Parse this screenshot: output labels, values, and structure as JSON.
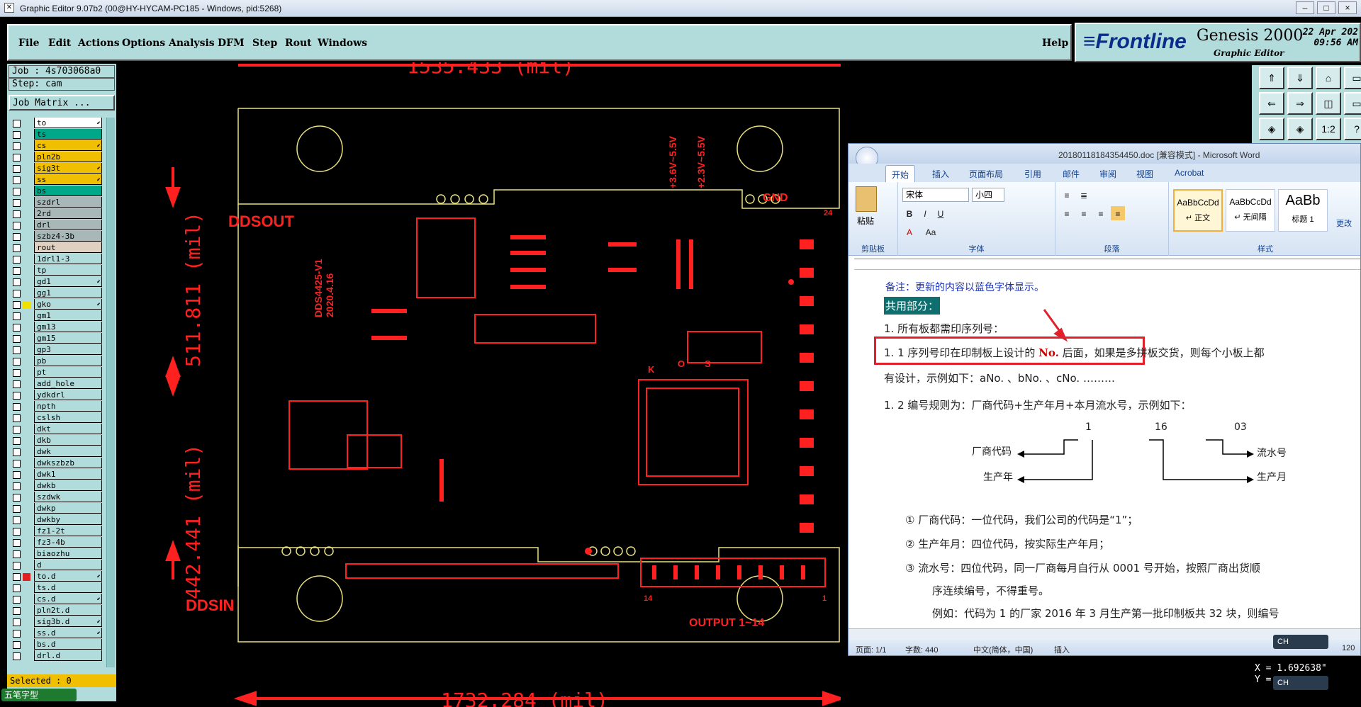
{
  "window": {
    "title": "Graphic Editor 9.07b2 (00@HY-HYCAM-PC185 - Windows, pid:5268)",
    "buttons": [
      "–",
      "□",
      "×"
    ]
  },
  "menu": {
    "items": [
      "File",
      "Edit",
      "Actions",
      "Options",
      "Analysis",
      "DFM",
      "Step",
      "Rout",
      "Windows"
    ],
    "help": "Help"
  },
  "brand": {
    "logo_a": "≡F",
    "logo_b": "rontline",
    "product": "Genesis 2000",
    "subtitle": "Graphic Editor",
    "date": "22 Apr 202",
    "time": "09:56 AM"
  },
  "job": {
    "job": "Job : 4s703068a0",
    "step": "Step: cam",
    "matrix": "Job Matrix ..."
  },
  "layers": [
    {
      "name": "to",
      "color": "#ffffff",
      "arrow": true
    },
    {
      "name": "ts",
      "color": "#00a88a",
      "arrow": false
    },
    {
      "name": "cs",
      "color": "#f0c000",
      "arrow": true
    },
    {
      "name": "pln2b",
      "color": "#f0c000",
      "arrow": false
    },
    {
      "name": "sig3t",
      "color": "#f0c000",
      "arrow": true
    },
    {
      "name": "ss",
      "color": "#f0c000",
      "arrow": true
    },
    {
      "name": "bs",
      "color": "#00a88a",
      "arrow": false
    },
    {
      "name": "szdrl",
      "color": "#a8b8b8",
      "arrow": false
    },
    {
      "name": "2rd",
      "color": "#a8b8b8",
      "arrow": false
    },
    {
      "name": "drl",
      "color": "#a8b8b8",
      "arrow": false
    },
    {
      "name": "szbz4-3b",
      "color": "#a8b8b8",
      "arrow": false
    },
    {
      "name": "rout",
      "color": "#e0d0c0",
      "arrow": false
    },
    {
      "name": "1drl1-3",
      "color": "#b2dcdc",
      "arrow": false
    },
    {
      "name": "tp",
      "color": "#b2dcdc",
      "arrow": false
    },
    {
      "name": "gd1",
      "color": "#b2dcdc",
      "arrow": true
    },
    {
      "name": "gg1",
      "color": "#b2dcdc",
      "arrow": false
    },
    {
      "name": "gko",
      "color": "#b2dcdc",
      "arrow": true
    },
    {
      "name": "gm1",
      "color": "#b2dcdc",
      "arrow": false
    },
    {
      "name": "gm13",
      "color": "#b2dcdc",
      "arrow": false
    },
    {
      "name": "gm15",
      "color": "#b2dcdc",
      "arrow": false
    },
    {
      "name": "gp3",
      "color": "#b2dcdc",
      "arrow": false
    },
    {
      "name": "pb",
      "color": "#b2dcdc",
      "arrow": false
    },
    {
      "name": "pt",
      "color": "#b2dcdc",
      "arrow": false
    },
    {
      "name": "add_hole",
      "color": "#b2dcdc",
      "arrow": false
    },
    {
      "name": "ydkdrl",
      "color": "#b2dcdc",
      "arrow": false
    },
    {
      "name": "npth",
      "color": "#b2dcdc",
      "arrow": false
    },
    {
      "name": "cslsh",
      "color": "#b2dcdc",
      "arrow": false
    },
    {
      "name": "dkt",
      "color": "#b2dcdc",
      "arrow": false
    },
    {
      "name": "dkb",
      "color": "#b2dcdc",
      "arrow": false
    },
    {
      "name": "dwk",
      "color": "#b2dcdc",
      "arrow": false
    },
    {
      "name": "dwkszbzb",
      "color": "#b2dcdc",
      "arrow": false
    },
    {
      "name": "dwk1",
      "color": "#b2dcdc",
      "arrow": false
    },
    {
      "name": "dwkb",
      "color": "#b2dcdc",
      "arrow": false
    },
    {
      "name": "szdwk",
      "color": "#b2dcdc",
      "arrow": false
    },
    {
      "name": "dwkp",
      "color": "#b2dcdc",
      "arrow": false
    },
    {
      "name": "dwkby",
      "color": "#b2dcdc",
      "arrow": false
    },
    {
      "name": "fz1-2t",
      "color": "#b2dcdc",
      "arrow": false
    },
    {
      "name": "fz3-4b",
      "color": "#b2dcdc",
      "arrow": false
    },
    {
      "name": "biaozhu",
      "color": "#b2dcdc",
      "arrow": false
    },
    {
      "name": "d",
      "color": "#b2dcdc",
      "arrow": false
    },
    {
      "name": "to.d",
      "color": "#b2dcdc",
      "arrow": true
    },
    {
      "name": "ts.d",
      "color": "#b2dcdc",
      "arrow": false
    },
    {
      "name": "cs.d",
      "color": "#b2dcdc",
      "arrow": true
    },
    {
      "name": "pln2t.d",
      "color": "#b2dcdc",
      "arrow": false
    },
    {
      "name": "sig3b.d",
      "color": "#b2dcdc",
      "arrow": true
    },
    {
      "name": "ss.d",
      "color": "#b2dcdc",
      "arrow": true
    },
    {
      "name": "bs.d",
      "color": "#b2dcdc",
      "arrow": false
    },
    {
      "name": "drl.d",
      "color": "#b2dcdc",
      "arrow": false
    }
  ],
  "selected": "Selected : 0",
  "ime": {
    "left": "五笔字型",
    "right": "CH"
  },
  "pcb": {
    "dim_top": "1535.433 (mil)",
    "dim_bottom": "1732.284 (mil)",
    "dim_left_a": "511.811 (mil)",
    "dim_left_b": "442.441 (mil)",
    "label_ddsout": "DDSOUT",
    "label_ddsin": "DDSIN",
    "label_gnd": "GND",
    "label_output": "OUTPUT 1~14",
    "label_v1": "+3.6V~5.5V",
    "label_v2": "+2.3V~5.5V",
    "label_board": "DDS4425-V1",
    "label_date": "2020.4.16",
    "pin_24": "24",
    "pin_14": "14",
    "pin_1": "1",
    "k": "K",
    "o": "O",
    "s": "S"
  },
  "tools": [
    "⇑",
    "⇓",
    "⌂",
    "▭",
    "⇐",
    "⇒",
    "◫",
    "▭",
    "◈",
    "◈",
    "1:2",
    "?"
  ],
  "coords": {
    "x": "X = 1.692638\"",
    "y": "Y = "
  },
  "word": {
    "title": "20180118184354450.doc [兼容模式] - Microsoft Word",
    "tabs": [
      "开始",
      "插入",
      "页面布局",
      "引用",
      "邮件",
      "审阅",
      "视图",
      "Acrobat"
    ],
    "font_name": "宋体",
    "font_size": "小四",
    "groups": [
      "剪贴板",
      "字体",
      "段落",
      "样式"
    ],
    "paste": "粘贴",
    "styles": [
      {
        "sample": "AaBbCcDd",
        "name": "↵ 正文"
      },
      {
        "sample": "AaBbCcDd",
        "name": "↵ 无间隔"
      },
      {
        "sample": "AaBb",
        "name": "标题 1"
      }
    ],
    "more": "更改",
    "doc": {
      "note": "备注：更新的内容以蓝色字体显示。",
      "heading": "共用部分：",
      "p1": "1. 所有板都需印序列号：",
      "p11a": "1. 1 序列号印在印制板上设计的 ",
      "p11b": "No.",
      "p11c": "  后面，",
      "p11d": "如果是多拼板交货，则每个小板上都",
      "p11e": "有设计，示例如下：aNo.  、bNo. 、cNo. ………",
      "p12": "1. 2  编号规则为：厂商代码+生产年月+本月流水号，示例如下：",
      "n1": "1",
      "n16": "16",
      "n03": "03",
      "l_factory": "厂商代码",
      "l_year": "生产年",
      "r_serial": "流水号",
      "r_month": "生产月",
      "c1": "①    厂商代码：一位代码，我们公司的代码是“1”；",
      "c2": "②    生产年月：四位代码，按实际生产年月；",
      "c3": "③    流水号：四位代码，同一厂商每月自行从 0001 号开始，按照厂商出货顺",
      "c3b": "序连续编号，不得重号。",
      "c4": "例如：代码为 1 的厂家 2016 年 3 月生产第一批印制板共 32 块，则编号"
    },
    "status": {
      "page": "页面: 1/1",
      "words": "字数: 440",
      "lang": "中文(简体，中国)",
      "mode": "插入",
      "zoom": "120"
    }
  }
}
